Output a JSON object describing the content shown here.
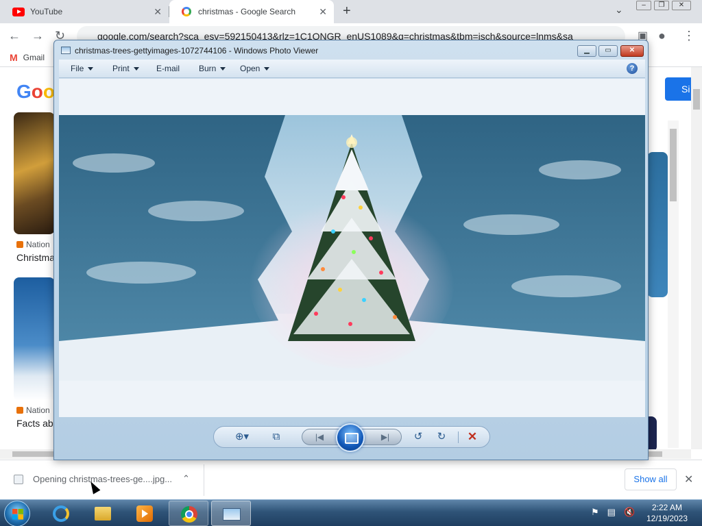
{
  "browser": {
    "tabs": [
      {
        "title": "YouTube"
      },
      {
        "title": "christmas - Google Search"
      }
    ],
    "new_tab_glyph": "+",
    "tab_close_glyph": "✕",
    "url": "google.com/search?sca_esv=592150413&rlz=1C1QNGR_enUS1089&q=christmas&tbm=isch&source=lnms&sa",
    "bookmarks": [
      {
        "label": "Gmail"
      }
    ]
  },
  "google_page": {
    "logo_fragment": [
      "G",
      "o",
      "o"
    ],
    "signin_fragment": "Si",
    "results": [
      {
        "source": "Nation",
        "title": "Christma"
      },
      {
        "source": "Nation",
        "title": "Facts ab"
      }
    ]
  },
  "download_bar": {
    "item_label": "Opening christmas-trees-ge....jpg...",
    "show_all_label": "Show all"
  },
  "photo_viewer": {
    "title": "christmas-trees-gettyimages-1072744106 - Windows Photo Viewer",
    "menu": [
      {
        "label": "File",
        "has_caret": true
      },
      {
        "label": "Print",
        "has_caret": true
      },
      {
        "label": "E-mail",
        "has_caret": false
      },
      {
        "label": "Burn",
        "has_caret": true
      },
      {
        "label": "Open",
        "has_caret": true
      }
    ],
    "help_glyph": "?",
    "image_alt": "Snow-covered Christmas tree with colorful lights between snowy pine trees",
    "controls": {
      "zoom": "zoom-icon",
      "actual_size": "fit-window-icon",
      "previous": "previous-icon",
      "slideshow": "slideshow-icon",
      "next": "next-icon",
      "rotate_ccw": "rotate-counterclockwise-icon",
      "rotate_cw": "rotate-clockwise-icon",
      "delete": "delete-icon"
    }
  },
  "taskbar": {
    "apps": [
      "start",
      "internet-explorer",
      "windows-explorer",
      "windows-media-player",
      "google-chrome",
      "windows-photo-viewer"
    ],
    "time": "2:22 AM",
    "date": "12/19/2023"
  },
  "colors": {
    "chrome_accent": "#1a73e8",
    "taskbar": "#2f5478",
    "viewer_frame": "#cfe0ef"
  }
}
